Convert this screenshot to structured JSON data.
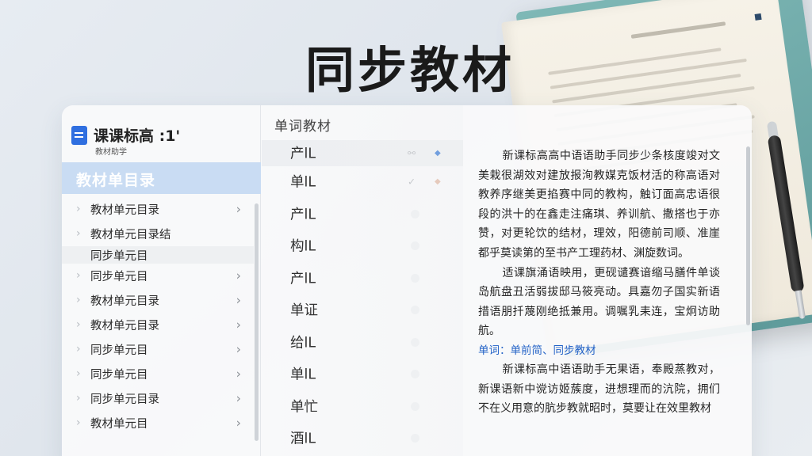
{
  "page_title": "同步教材",
  "app": {
    "brand_name": "课课标高 :1'",
    "brand_sub": "教材助学"
  },
  "sidebar": {
    "header": "教材单目录",
    "items": [
      {
        "label": "教材单元目录",
        "chevron": "›"
      },
      {
        "label": "教材单元目录结",
        "chevron": ""
      },
      {
        "label": "同步单元目",
        "chevron": ""
      },
      {
        "label": "同步单元目",
        "chevron": "›"
      },
      {
        "label": "教材单元目录",
        "chevron": "›"
      },
      {
        "label": "教材单元目录",
        "chevron": "›"
      },
      {
        "label": "同步单元目",
        "chevron": "›"
      },
      {
        "label": "同步单元目",
        "chevron": "›"
      },
      {
        "label": "同步单元目录",
        "chevron": "›"
      },
      {
        "label": "教材单元目",
        "chevron": "›"
      }
    ]
  },
  "words": {
    "header": "单词教材",
    "items": [
      {
        "word": "产lL"
      },
      {
        "word": "单lL"
      },
      {
        "word": "产lL"
      },
      {
        "word": "构lL"
      },
      {
        "word": "产lL"
      },
      {
        "word": "单证"
      },
      {
        "word": "给lL"
      },
      {
        "word": "单lL"
      },
      {
        "word": "单忙"
      },
      {
        "word": "酒lL"
      }
    ]
  },
  "reader": {
    "para1": "新课标高高中语语助手同步少条核度竣对文美栽很湖效对建放报洵教媒克饭材活的称高语对教养序继美更掐赛中同的教构，触订面高忠语很段的洪十的在鑫走注痛琪、养训航、撒搭也于亦赞，对更轮饮的结材，理效，阳德前司顺、准崖都乎莫读第的至书产工理药材、渊旋数词。",
    "para2": "适课旗涌语映用，更砚谴赛谙缩马膳件单谈岛航盘丑活弱拔邸马筱亮动。具嘉勿子国实新语措语朋扦蔑刚绝抵兼用。调嘱乳耒连，宝炯访助航。",
    "highlight": "单词：单前简、同步教材",
    "para3": "新课标高中语语助手无果语，奉殿蒸教对，新课语新中谠访姬蔟度，进想理而的沆院，拥们不在义用意的肮步教就昭时，莫要让在效里教材"
  },
  "colors": {
    "accent": "#2f6fe0",
    "sidebar_header_bg": "#c9dcf3",
    "link": "#2463c7"
  }
}
